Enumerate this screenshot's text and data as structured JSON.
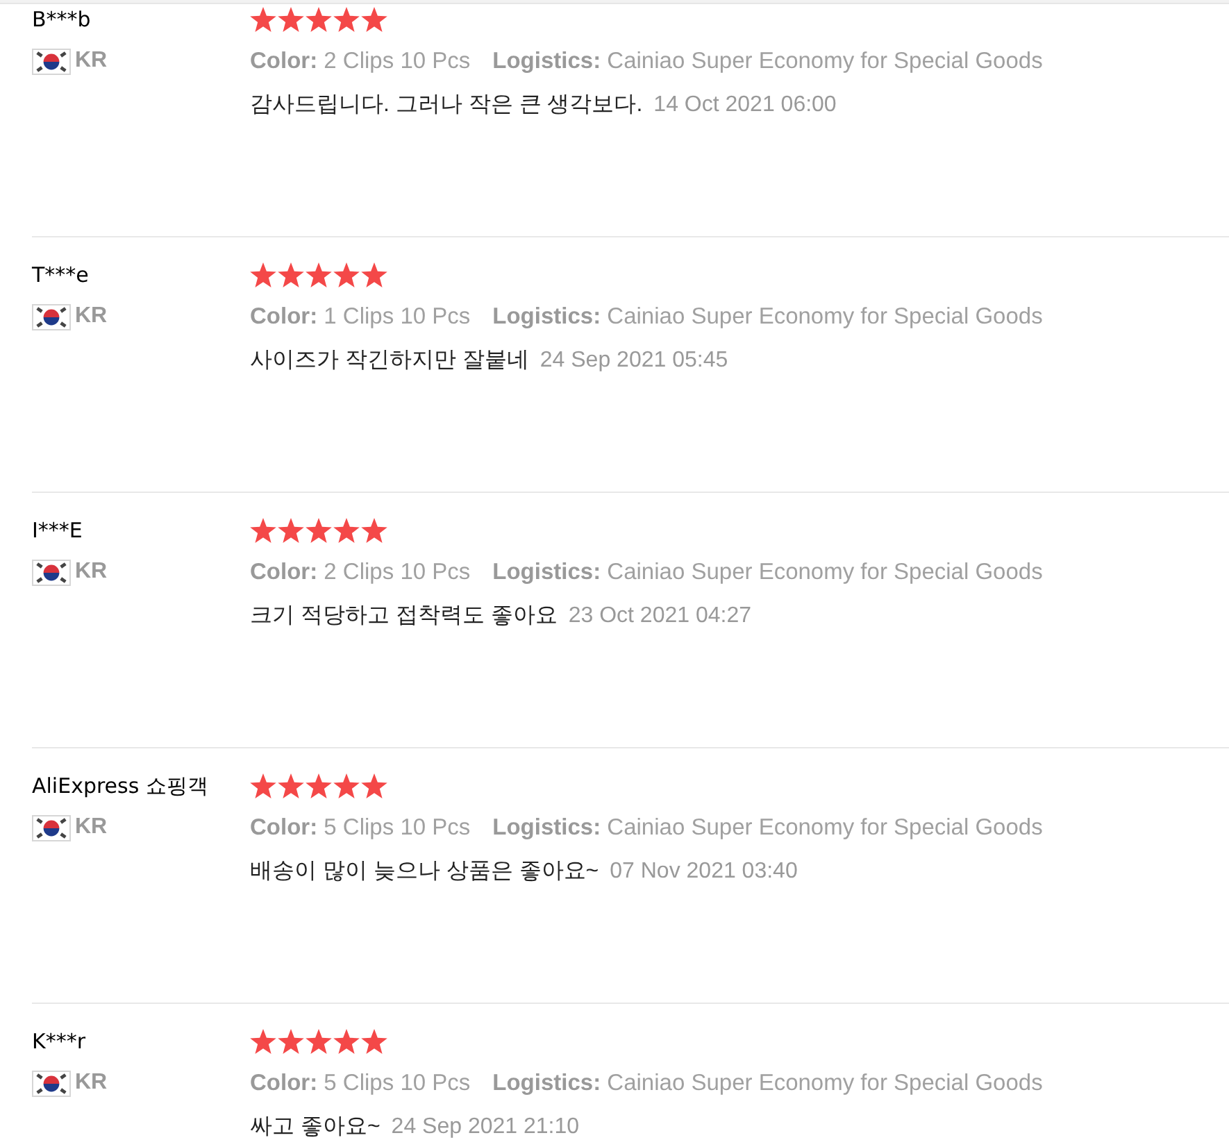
{
  "reviews": [
    {
      "name": "B***b",
      "country": "KR",
      "stars": 5,
      "attributes": [
        {
          "label": "Color:",
          "value": "2 Clips 10 Pcs"
        },
        {
          "label": "Logistics:",
          "value": "Cainiao Super Economy for Special Goods"
        }
      ],
      "comment": "감사드립니다. 그러나 작은 큰 생각보다.",
      "date": "14 Oct 2021 06:00"
    },
    {
      "name": "T***e",
      "country": "KR",
      "stars": 5,
      "attributes": [
        {
          "label": "Color:",
          "value": "1 Clips 10 Pcs"
        },
        {
          "label": "Logistics:",
          "value": "Cainiao Super Economy for Special Goods"
        }
      ],
      "comment": "사이즈가 작긴하지만 잘붙네",
      "date": "24 Sep 2021 05:45"
    },
    {
      "name": "I***E",
      "country": "KR",
      "stars": 5,
      "attributes": [
        {
          "label": "Color:",
          "value": "2 Clips 10 Pcs"
        },
        {
          "label": "Logistics:",
          "value": "Cainiao Super Economy for Special Goods"
        }
      ],
      "comment": "크기 적당하고 접착력도 좋아요",
      "date": "23 Oct 2021 04:27"
    },
    {
      "name": "AliExpress 쇼핑객",
      "country": "KR",
      "stars": 5,
      "attributes": [
        {
          "label": "Color:",
          "value": "5 Clips 10 Pcs"
        },
        {
          "label": "Logistics:",
          "value": "Cainiao Super Economy for Special Goods"
        }
      ],
      "comment": "배송이 많이 늦으나 상품은 좋아요~",
      "date": "07 Nov 2021 03:40"
    },
    {
      "name": "K***r",
      "country": "KR",
      "stars": 5,
      "attributes": [
        {
          "label": "Color:",
          "value": "5 Clips 10 Pcs"
        },
        {
          "label": "Logistics:",
          "value": "Cainiao Super Economy for Special Goods"
        }
      ],
      "comment": "싸고 좋아요~",
      "date": "24 Sep 2021 21:10"
    }
  ]
}
